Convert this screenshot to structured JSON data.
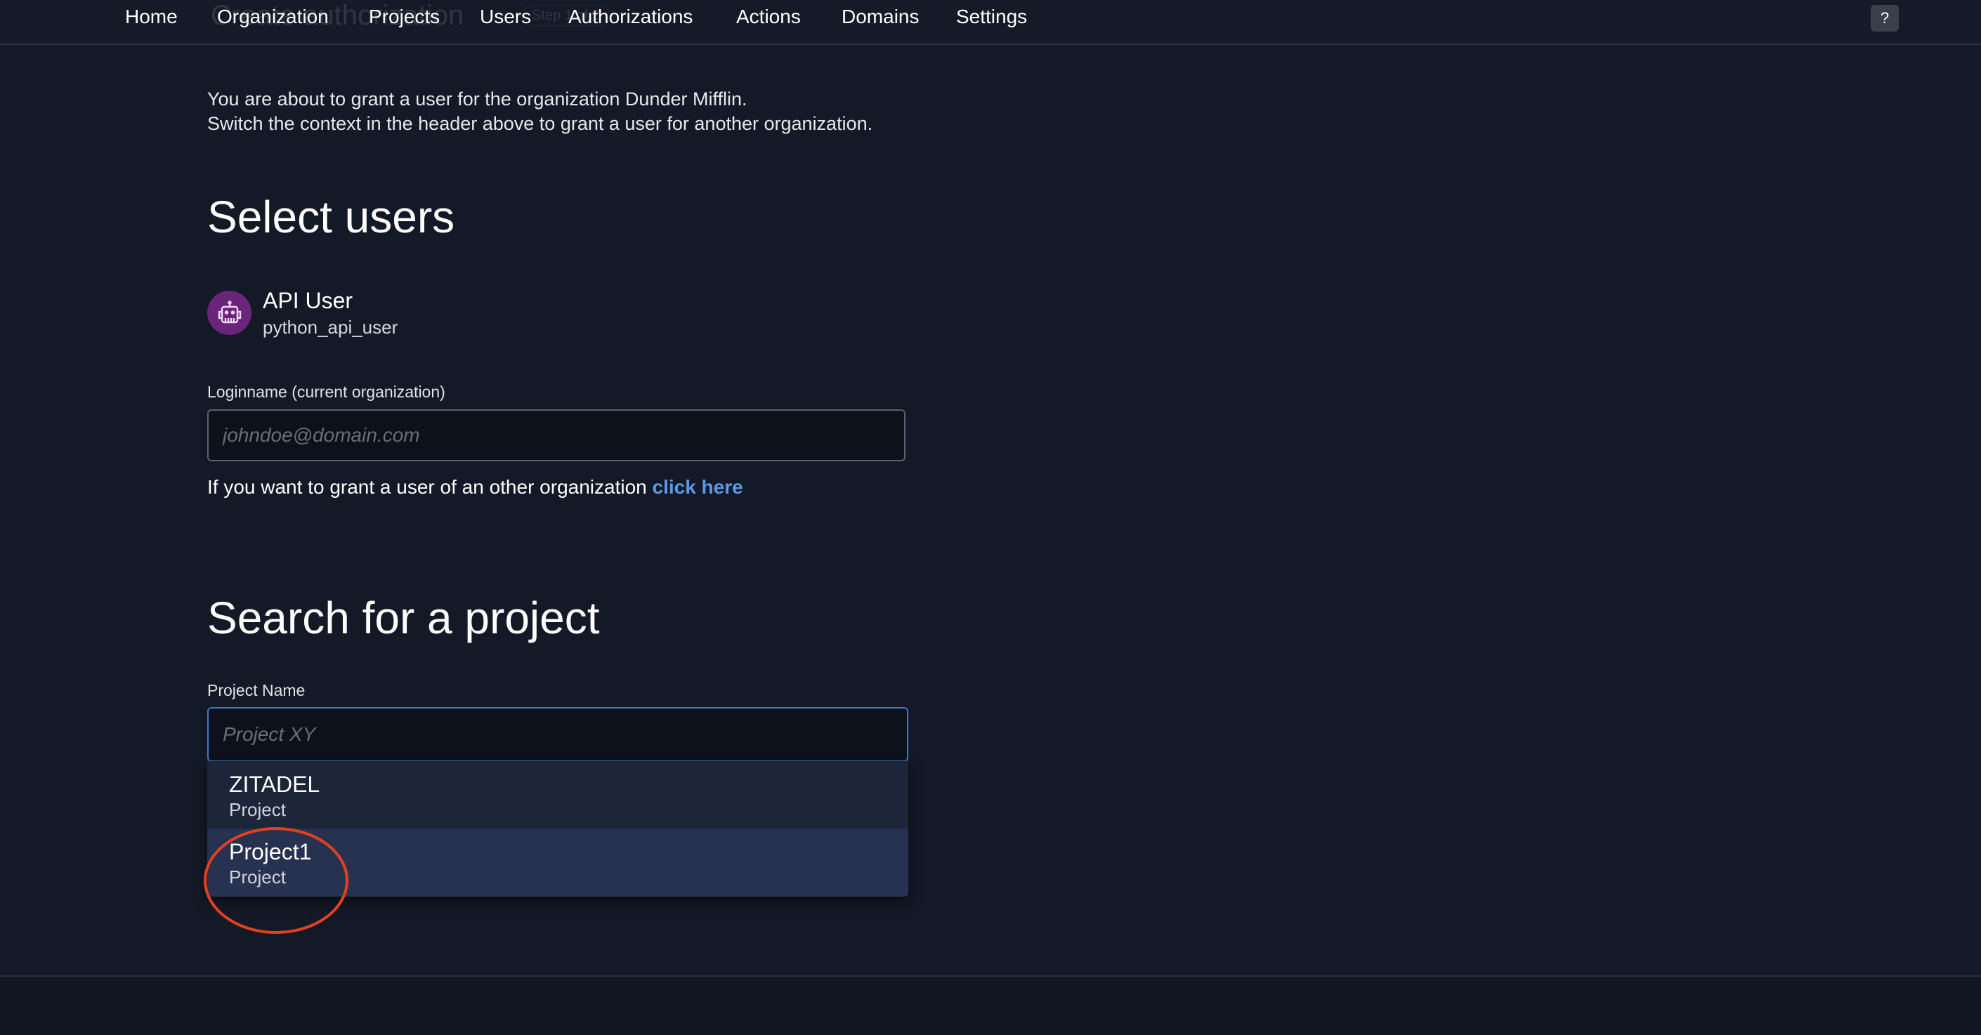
{
  "header": {
    "ghost_title": "Create authorization",
    "ghost_step": "Step 1 of 2",
    "nav": [
      "Home",
      "Organization",
      "Projects",
      "Users",
      "Authorizations",
      "Actions",
      "Domains",
      "Settings"
    ],
    "help_label": "?"
  },
  "intro": {
    "line1": "You are about to grant a user for the organization Dunder Mifflin.",
    "line2": "Switch the context in the header above to grant a user for another organization."
  },
  "select_users": {
    "title": "Select users",
    "user": {
      "name": "API User",
      "login": "python_api_user",
      "avatar_icon": "robot-icon",
      "avatar_color": "#6a2479"
    },
    "loginname_label": "Loginname (current organization)",
    "loginname_placeholder": "johndoe@domain.com",
    "hint_text": "If you want to grant a user of an other organization ",
    "hint_link": "click here"
  },
  "project_search": {
    "title": "Search for a project",
    "label": "Project Name",
    "placeholder": "Project XY",
    "options": [
      {
        "name": "ZITADEL",
        "type": "Project"
      },
      {
        "name": "Project1",
        "type": "Project"
      }
    ],
    "highlight_color": "#e2401f"
  }
}
